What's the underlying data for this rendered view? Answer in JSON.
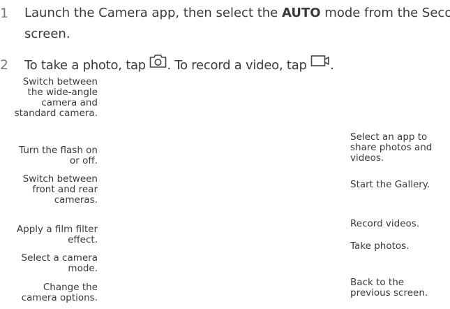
{
  "steps": [
    {
      "number": "1",
      "line1_before": "Launch the Camera app, then select the ",
      "line1_bold": "AUTO",
      "line1_after": " mode from the Second",
      "line2": "screen."
    },
    {
      "number": "2",
      "text_before_photo_icon": "To take a photo, tap ",
      "photo_icon": "camera-icon",
      "text_before_video_icon": ". To record a video, tap ",
      "video_icon": "video-camera-icon",
      "text_end": "."
    }
  ],
  "left_callouts": [
    [
      "Switch between",
      "the wide-angle",
      "camera and",
      "standard camera."
    ],
    [
      "Turn the flash on",
      "or off."
    ],
    [
      "Switch between",
      "front and rear",
      "cameras."
    ],
    [
      "Apply a film filter",
      "effect."
    ],
    [
      "Select a camera",
      "mode."
    ],
    [
      "Change the",
      "camera options."
    ]
  ],
  "right_callouts": [
    [
      "Select an app to",
      "share photos and",
      "videos."
    ],
    [
      "Start the Gallery."
    ],
    [
      "Record videos."
    ],
    [
      "Take photos."
    ],
    [
      "Back to the",
      "previous screen."
    ]
  ]
}
